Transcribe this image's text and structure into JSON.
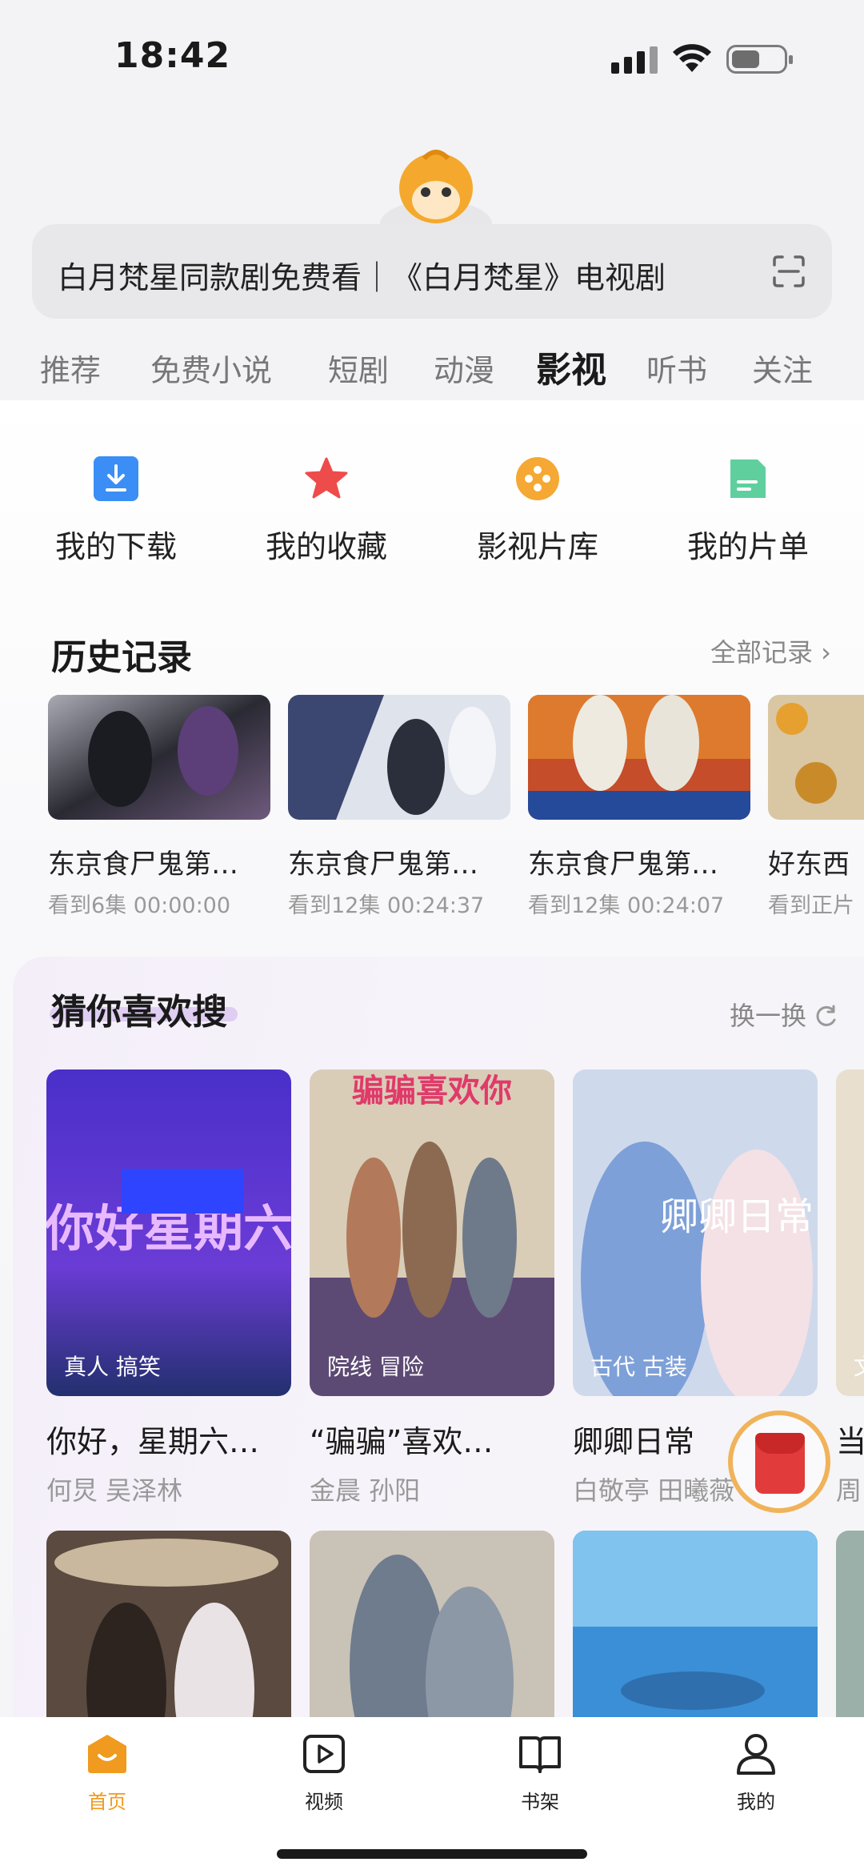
{
  "status_bar": {
    "time": "18:42"
  },
  "search": {
    "text": "白月梵星同款剧免费看｜《白月梵星》电视剧"
  },
  "tabs": [
    {
      "label": "推荐"
    },
    {
      "label": "免费小说"
    },
    {
      "label": "短剧"
    },
    {
      "label": "动漫"
    },
    {
      "label": "影视",
      "active": true
    },
    {
      "label": "听书"
    },
    {
      "label": "关注"
    }
  ],
  "quick_actions": [
    {
      "label": "我的下载",
      "icon": "download-icon"
    },
    {
      "label": "我的收藏",
      "icon": "star-icon"
    },
    {
      "label": "影视片库",
      "icon": "film-reel-icon"
    },
    {
      "label": "我的片单",
      "icon": "list-doc-icon"
    }
  ],
  "history": {
    "title": "历史记录",
    "more": "全部记录 ›",
    "items": [
      {
        "title": "东京食尸鬼第…",
        "progress": "看到6集 00:00:00"
      },
      {
        "title": "东京食尸鬼第…",
        "progress": "看到12集 00:24:37"
      },
      {
        "title": "东京食尸鬼第…",
        "progress": "看到12集 00:24:07"
      },
      {
        "title": "好东西",
        "progress": "看到正片"
      }
    ]
  },
  "guess": {
    "title": "猜你喜欢搜",
    "more": "换一换",
    "items": [
      {
        "title": "你好，星期六…",
        "tags": "真人 搞笑",
        "cast": "何炅 吴泽林",
        "poster_text": "你好星期六"
      },
      {
        "title": "“骗骗”喜欢…",
        "tags": "院线 冒险",
        "cast": "金晨 孙阳",
        "poster_text": "骗骗喜欢你"
      },
      {
        "title": "卿卿日常",
        "tags": "古代 古装",
        "cast": "白敬亭 田曦薇",
        "poster_text": "卿卿日常"
      },
      {
        "title": "当",
        "tags": "文",
        "cast": "周"
      }
    ]
  },
  "bottom_nav": [
    {
      "label": "首页",
      "active": true
    },
    {
      "label": "视频"
    },
    {
      "label": "书架"
    },
    {
      "label": "我的"
    }
  ],
  "colors": {
    "accent": "#f09a1f",
    "download_blue": "#3a8ef6",
    "star_red": "#ee4b4b",
    "reel_orange": "#f5a833",
    "list_green": "#5fcf9e"
  }
}
